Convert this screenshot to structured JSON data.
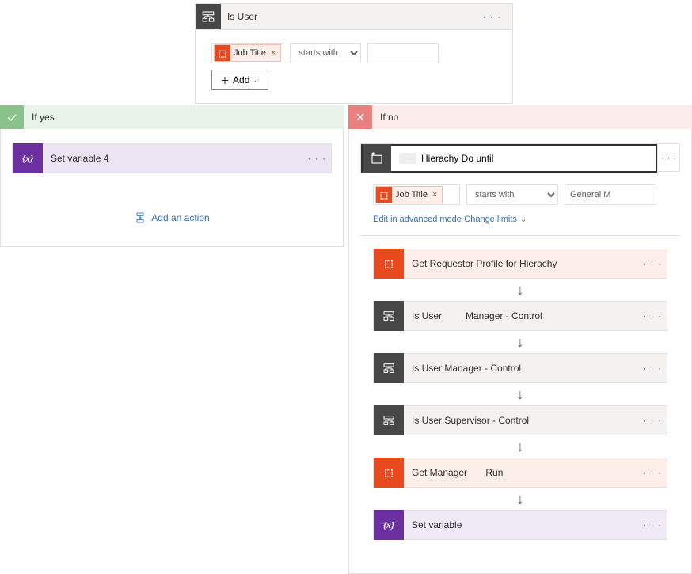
{
  "topCondition": {
    "title": "Is User",
    "moreLabel": "· · ·",
    "tokenLabel": "Job Title",
    "operator": "starts with",
    "value": "",
    "addLabel": "Add"
  },
  "yesBranch": {
    "label": "If yes",
    "action": {
      "label": "Set variable 4",
      "moreLabel": "· · ·"
    },
    "addActionLabel": "Add an action"
  },
  "noBranch": {
    "label": "If no",
    "loop": {
      "title": "Hierachy Do until",
      "moreLabel": "· · ·",
      "tokenLabel": "Job Title",
      "operator": "starts with",
      "value": "General M",
      "advancedLink": "Edit in advanced mode",
      "limitsLink": "Change limits",
      "steps": [
        {
          "kind": "office",
          "label": "Get Requestor Profile for Hierachy",
          "moreLabel": "· · ·"
        },
        {
          "kind": "cond",
          "label": "Is User         Manager - Control",
          "moreLabel": "· · ·"
        },
        {
          "kind": "cond",
          "label": "Is User Manager - Control",
          "moreLabel": "· · ·"
        },
        {
          "kind": "cond",
          "label": "Is User Supervisor - Control",
          "moreLabel": "· · ·"
        },
        {
          "kind": "office",
          "label": "Get Manager       Run",
          "moreLabel": "· · ·"
        },
        {
          "kind": "var",
          "label": "Set variable",
          "moreLabel": "· · ·"
        }
      ]
    }
  }
}
